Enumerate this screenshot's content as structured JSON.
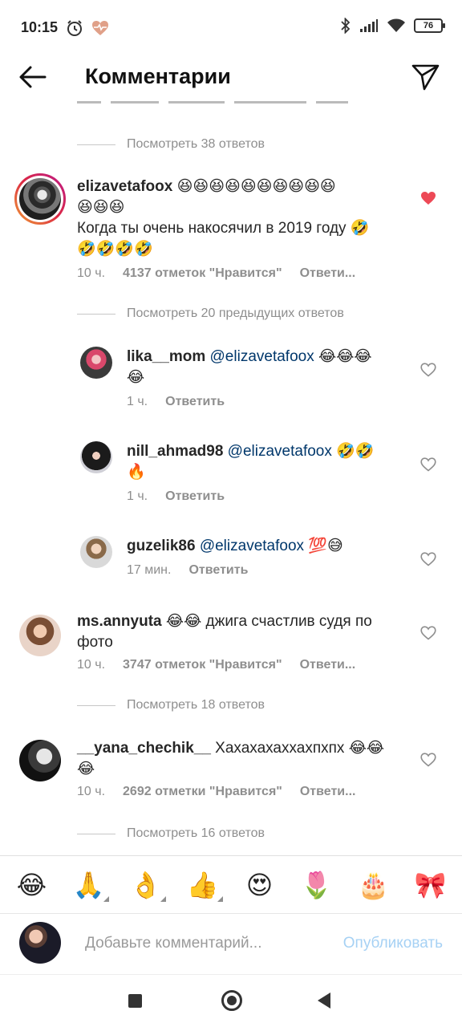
{
  "status": {
    "time": "10:15",
    "battery": "76"
  },
  "header": {
    "title": "Комментарии"
  },
  "threads": {
    "view_38": "Посмотреть 38 ответов",
    "view_prev_20": "Посмотреть 20 предыдущих ответов",
    "view_18": "Посмотреть 18 ответов",
    "view_16": "Посмотреть 16 ответов"
  },
  "comments": [
    {
      "username": "elizavetafoox",
      "text_line1": " 😆😆😆😆😆😆😆😆😆😆",
      "text_line2": "😆😆😆",
      "text_line3": "Когда ты очень накосячил в 2019 году 🤣",
      "text_line4": "🤣🤣🤣🤣",
      "time": "10 ч.",
      "likes": "4137 отметок \"Нравится\"",
      "reply": "Ответи...",
      "liked": true
    },
    {
      "username": "lika__mom",
      "mention": "@elizavetafoox",
      "emoji": " 😂😂😂",
      "text_line2": "😂",
      "time": "1 ч.",
      "reply": "Ответить"
    },
    {
      "username": "nill_ahmad98",
      "mention": "@elizavetafoox",
      "emoji": " 🤣🤣",
      "text_line2": "🔥",
      "time": "1 ч.",
      "reply": "Ответить"
    },
    {
      "username": "guzelik86",
      "mention": "@elizavetafoox",
      "emoji": " 💯😅",
      "time": "17 мин.",
      "reply": "Ответить"
    },
    {
      "username": "ms.annyuta",
      "text": " 😂😂 джига счастлив судя по",
      "text_line2": "фото",
      "time": "10 ч.",
      "likes": "3747 отметок \"Нравится\"",
      "reply": "Ответи..."
    },
    {
      "username": "__yana_chechik__",
      "text": " Хахахахаххахпхпх 😂😂",
      "text_line2": "😂",
      "time": "10 ч.",
      "likes": "2692 отметки \"Нравится\"",
      "reply": "Ответи..."
    }
  ],
  "emoji_bar": [
    "😂",
    "🙏",
    "👌",
    "👍",
    "😍",
    "🌷",
    "🎂",
    "🎀"
  ],
  "composer": {
    "placeholder": "Добавьте комментарий...",
    "publish": "Опубликовать"
  },
  "icons": [
    "clock-icon",
    "heart-monitor-icon",
    "bluetooth-icon",
    "signal-icon",
    "wifi-icon",
    "battery-icon",
    "back-arrow-icon",
    "send-icon",
    "heart-icon"
  ],
  "colors": {
    "like_red": "#ed4956",
    "mention_blue": "#00376b",
    "publish_blue": "#a6d1f4",
    "secondary_text": "#8e8e8e"
  }
}
